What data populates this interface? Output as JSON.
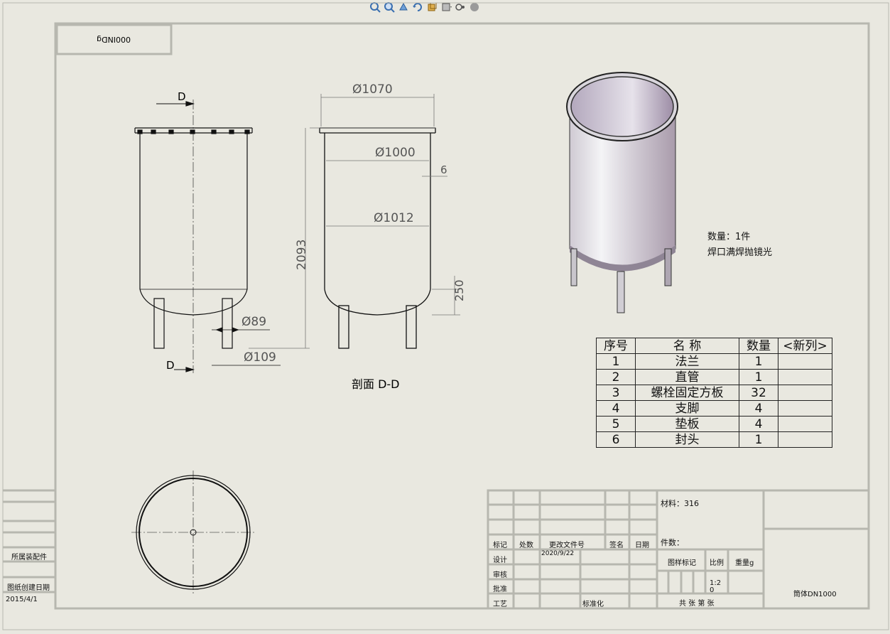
{
  "toolbar": {
    "icons": [
      "zoom-to-fit-icon",
      "zoom-area-icon",
      "previous-view-icon",
      "rotate-icon",
      "3d-view-icon",
      "display-style-icon",
      "view-settings-icon",
      "appearance-icon"
    ]
  },
  "title_block_top": {
    "mirrored_name": "000INDg"
  },
  "views": {
    "section_label_top": "D",
    "section_label_bottom": "D",
    "section_title": "剖面 D-D",
    "dims": {
      "outer_dia": "Ø1070",
      "inner_dia": "Ø1000",
      "wall": "6",
      "shell_dia": "Ø1012",
      "height": "2093",
      "leg_height": "250",
      "leg_dia": "Ø89",
      "leg_spacing": "Ø109"
    }
  },
  "notes": {
    "quantity": "数量：1件",
    "weld": "焊口满焊抛镜光"
  },
  "bom": {
    "headers": [
      "序号",
      "名  称",
      "数量",
      "<新列>"
    ],
    "rows": [
      [
        "1",
        "法兰",
        "1",
        ""
      ],
      [
        "2",
        "直管",
        "1",
        ""
      ],
      [
        "3",
        "螺栓固定方板",
        "32",
        ""
      ],
      [
        "4",
        "支脚",
        "4",
        ""
      ],
      [
        "5",
        "垫板",
        "4",
        ""
      ],
      [
        "6",
        "封头",
        "1",
        ""
      ]
    ]
  },
  "left_block": {
    "assembly": "所属装配件",
    "created_label": "图纸创建日期",
    "created_date": "2015/4/1"
  },
  "title_block": {
    "material": "材料：316",
    "part_no": "件数：",
    "mark": "标记",
    "count": "处数",
    "change_doc": "更改文件号",
    "sign": "签名",
    "date": "日期",
    "design": "设计",
    "design_date": "2020/9/22",
    "review": "审核",
    "approve": "批准",
    "process": "工艺",
    "standard": "标准化",
    "stage_mark": "图样标记",
    "scale_label": "比例",
    "weight_label": "重量g",
    "scale_value": "1:2",
    "scale_value2": "0",
    "sheets": "共  张  第  张",
    "drawing_name": "筒体DN1000"
  }
}
